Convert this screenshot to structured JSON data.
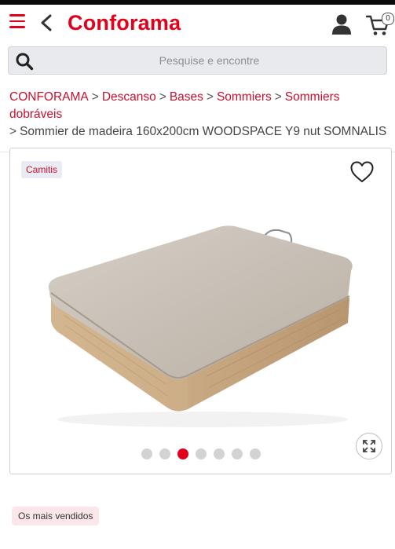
{
  "header": {
    "logo_text": "Conforama",
    "cart_count": "0",
    "brand_color": "#e2001a"
  },
  "icons": {
    "menu": "hamburger-menu-icon",
    "back": "chevron-left-icon",
    "user": "user-icon",
    "cart": "shopping-cart-icon",
    "search": "search-icon",
    "wishlist": "heart-icon",
    "expand": "expand-arrows-icon"
  },
  "search": {
    "placeholder": "Pesquise e encontre",
    "value": ""
  },
  "breadcrumb": {
    "items": [
      "CONFORAMA",
      "Descanso",
      "Bases",
      "Sommiers",
      "Sommiers dobráveis"
    ],
    "separator": ">",
    "current": "Sommier de madeira 160x200cm WOODSPACE Y9 nut SOMNALIS"
  },
  "product": {
    "brand": "Camitis",
    "image_count": 7,
    "active_image_index": 3
  },
  "badges": {
    "bestseller": "Os mais vendidos"
  }
}
